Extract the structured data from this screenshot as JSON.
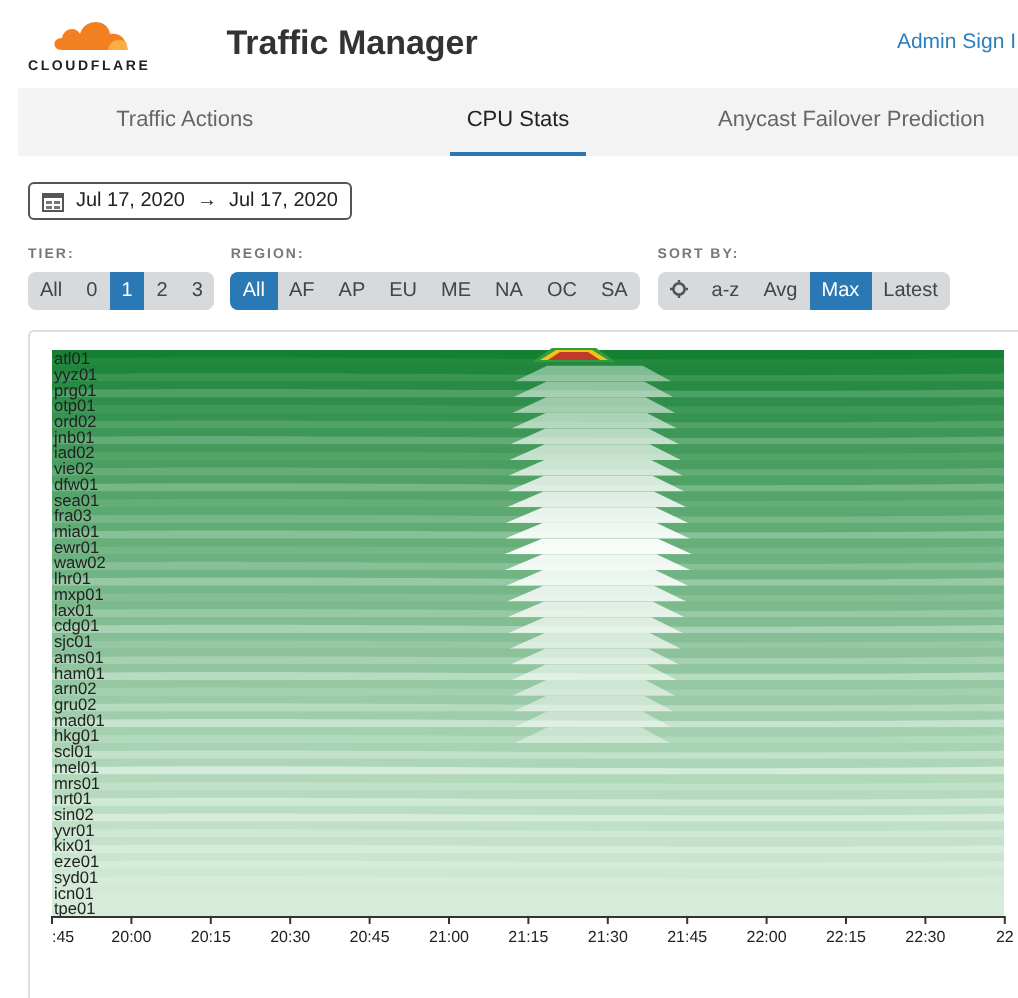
{
  "header": {
    "logo_text": "CLOUDFLARE",
    "title": "Traffic Manager",
    "admin_link": "Admin Sign I"
  },
  "tabs": [
    {
      "label": "Traffic Actions",
      "selected": false
    },
    {
      "label": "CPU Stats",
      "selected": true
    },
    {
      "label": "Anycast Failover Prediction",
      "selected": false
    }
  ],
  "date_range": {
    "start": "Jul 17, 2020",
    "arrow": "→",
    "end": "Jul 17, 2020"
  },
  "filters": [
    {
      "label": "TIER:",
      "options": [
        {
          "kind": "text",
          "label": "All",
          "selected": false
        },
        {
          "kind": "text",
          "label": "0",
          "selected": false
        },
        {
          "kind": "text",
          "label": "1",
          "selected": true
        },
        {
          "kind": "text",
          "label": "2",
          "selected": false
        },
        {
          "kind": "text",
          "label": "3",
          "selected": false
        }
      ]
    },
    {
      "label": "REGION:",
      "options": [
        {
          "kind": "text",
          "label": "All",
          "selected": true
        },
        {
          "kind": "text",
          "label": "AF",
          "selected": false
        },
        {
          "kind": "text",
          "label": "AP",
          "selected": false
        },
        {
          "kind": "text",
          "label": "EU",
          "selected": false
        },
        {
          "kind": "text",
          "label": "ME",
          "selected": false
        },
        {
          "kind": "text",
          "label": "NA",
          "selected": false
        },
        {
          "kind": "text",
          "label": "OC",
          "selected": false
        },
        {
          "kind": "text",
          "label": "SA",
          "selected": false
        }
      ]
    },
    {
      "label": "SORT BY:",
      "options": [
        {
          "kind": "icon",
          "selected": false
        },
        {
          "kind": "text",
          "label": "a-z",
          "selected": false
        },
        {
          "kind": "text",
          "label": "Avg",
          "selected": false
        },
        {
          "kind": "text",
          "label": "Max",
          "selected": true
        },
        {
          "kind": "text",
          "label": "Latest",
          "selected": false
        }
      ]
    }
  ],
  "chart": {
    "rows": [
      "atl01",
      "yyz01",
      "prg01",
      "otp01",
      "ord02",
      "jnb01",
      "iad02",
      "vie02",
      "dfw01",
      "sea01",
      "fra03",
      "mia01",
      "ewr01",
      "waw02",
      "lhr01",
      "mxp01",
      "lax01",
      "cdg01",
      "sjc01",
      "ams01",
      "ham01",
      "arn02",
      "gru02",
      "mad01",
      "hkg01",
      "scl01",
      "mel01",
      "mrs01",
      "nrt01",
      "sin02",
      "yvr01",
      "kix01",
      "eze01",
      "syd01",
      "icn01",
      "tpe01"
    ],
    "x_ticks": [
      ":45",
      "20:00",
      "20:15",
      "20:30",
      "20:45",
      "21:00",
      "21:15",
      "21:30",
      "21:45",
      "22:00",
      "22:15",
      "22:30",
      "22"
    ]
  }
}
